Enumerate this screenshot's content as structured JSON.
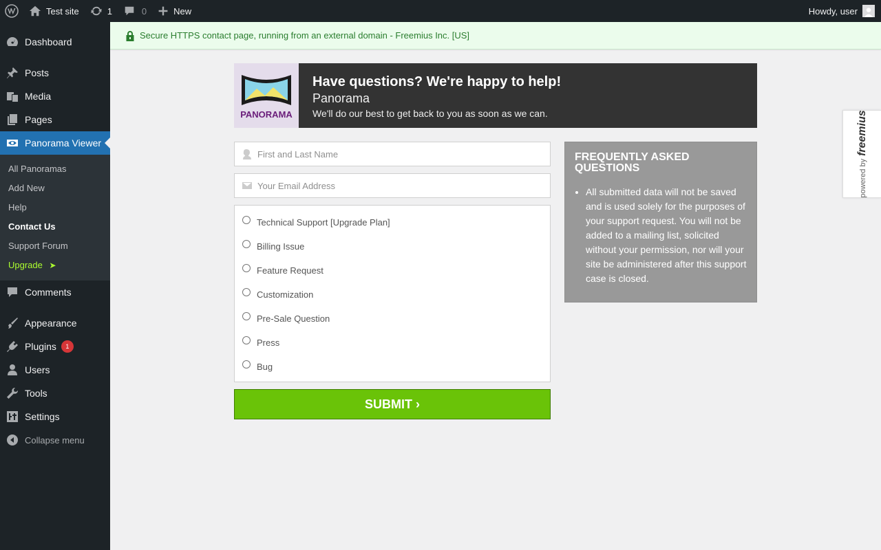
{
  "adminbar": {
    "site_name": "Test site",
    "updates_count": "1",
    "comments_count": "0",
    "new_label": "New",
    "howdy": "Howdy, user"
  },
  "sidebar": {
    "items_top": [
      {
        "label": "Dashboard",
        "icon": "dashboard-icon"
      }
    ],
    "items": [
      {
        "label": "Posts",
        "icon": "pushpin-icon"
      },
      {
        "label": "Media",
        "icon": "media-icon"
      },
      {
        "label": "Pages",
        "icon": "pages-icon"
      }
    ],
    "current": {
      "label": "Panorama Viewer",
      "icon": "visibility-icon"
    },
    "submenu": [
      {
        "label": "All Panoramas"
      },
      {
        "label": "Add New"
      },
      {
        "label": "Help"
      },
      {
        "label": "Contact Us"
      },
      {
        "label": "Support Forum"
      },
      {
        "label": "Upgrade",
        "arrow": "➤"
      }
    ],
    "after": {
      "comments": "Comments",
      "appearance": "Appearance",
      "plugins": "Plugins",
      "plugins_badge": "1",
      "users": "Users",
      "tools": "Tools",
      "settings": "Settings",
      "collapse": "Collapse menu"
    }
  },
  "notice": {
    "text": "Secure HTTPS contact page, running from an external domain - Freemius Inc. [US]",
    "icon": "lock-icon"
  },
  "header": {
    "logo_text": "PANORAMA",
    "title": "Have questions? We're happy to help!",
    "subtitle": "Panorama",
    "message": "We'll do our best to get back to you as soon as we can."
  },
  "form": {
    "name_placeholder": "First and Last Name",
    "email_placeholder": "Your Email Address",
    "topics": [
      "Technical Support [Upgrade Plan]",
      "Billing Issue",
      "Feature Request",
      "Customization",
      "Pre-Sale Question",
      "Press",
      "Bug"
    ],
    "submit_label": "SUBMIT ›"
  },
  "faq": {
    "title": "FREQUENTLY ASKED QUESTIONS",
    "items": [
      "All submitted data will not be saved and is used solely for the purposes of your support request. You will not be added to a mailing list, solicited without your permission, nor will your site be administered after this support case is closed."
    ]
  },
  "powered": {
    "small": "powered by",
    "brand": "freemius"
  },
  "colors": {
    "admin_dark": "#1d2327",
    "wp_blue": "#2271b1",
    "submit_green": "#6ac308",
    "notice_green": "#2a7d2e",
    "upgrade_green": "#adff2f"
  }
}
